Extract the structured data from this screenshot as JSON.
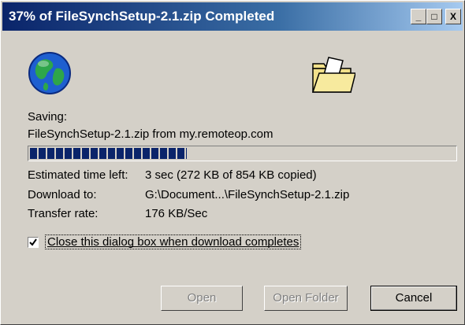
{
  "window": {
    "title": "37% of FileSynchSetup-2.1.zip Completed",
    "controls": {
      "minimize": "_",
      "maximize": "□",
      "close": "X"
    }
  },
  "icons": {
    "globe": "globe-icon",
    "folder": "folder-icon"
  },
  "status": {
    "saving_label": "Saving:",
    "file_from": "FileSynchSetup-2.1.zip from my.remoteop.com",
    "progress_percent": 37
  },
  "details": {
    "time_left_label": "Estimated time left:",
    "time_left_value": "3 sec (272 KB of 854 KB copied)",
    "download_to_label": "Download to:",
    "download_to_value": "G:\\Document...\\FileSynchSetup-2.1.zip",
    "transfer_rate_label": "Transfer rate:",
    "transfer_rate_value": "176 KB/Sec"
  },
  "options": {
    "close_when_done_label": "Close this dialog box when download completes",
    "close_when_done_checked": true
  },
  "buttons": {
    "open": "Open",
    "open_folder": "Open Folder",
    "cancel": "Cancel"
  },
  "colors": {
    "titlebar_start": "#0a246a",
    "titlebar_end": "#a6caf0",
    "dialog_bg": "#d4d0c8",
    "progress_fill": "#0a246a"
  }
}
